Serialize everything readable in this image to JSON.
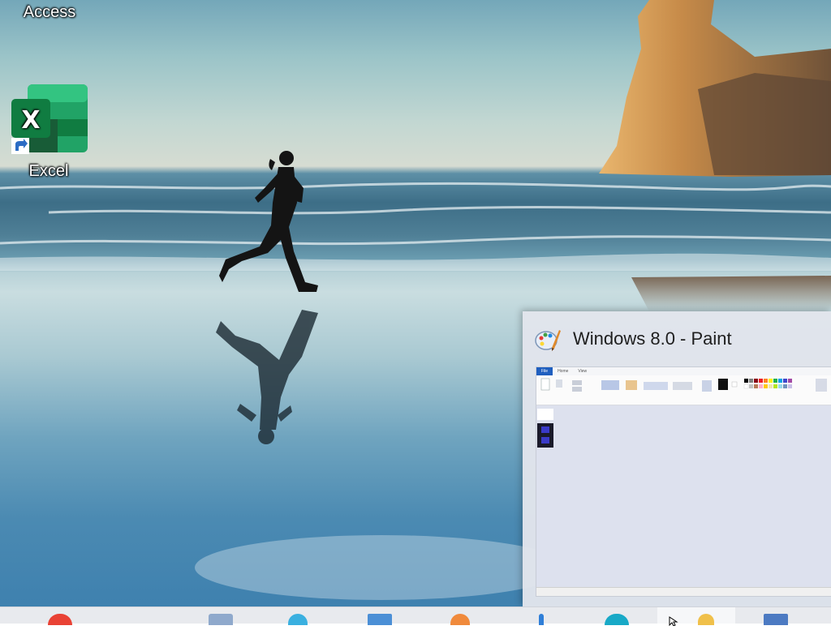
{
  "desktop": {
    "icons": [
      {
        "label": "Access",
        "icon": "access-icon"
      },
      {
        "label": "Excel",
        "icon": "excel-icon"
      }
    ]
  },
  "preview": {
    "title": "Windows 8.0 - Paint",
    "icon": "paint-palette-icon",
    "thumb_tabs": [
      "File",
      "Home",
      "View"
    ]
  },
  "taskbar": {
    "buttons": [
      "chrome-icon",
      "window-icon",
      "edge-icon",
      "mail-icon",
      "browser-icon",
      "edge-blue-icon",
      "paint-icon",
      "app-icon"
    ],
    "active": "paint-icon"
  },
  "colors": {
    "excel_green": "#107c41",
    "paint_title": "#1e1e1e",
    "taskbar": "#e8eaee"
  }
}
